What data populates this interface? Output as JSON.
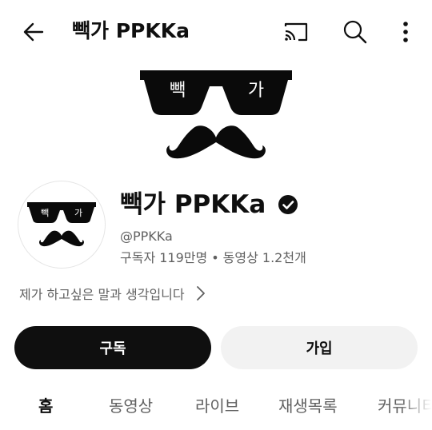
{
  "topbar": {
    "title": "빽가 PPKKa",
    "back_icon": "arrow-left-icon",
    "cast_icon": "cast-icon",
    "search_icon": "search-icon",
    "more_icon": "more-vert-icon"
  },
  "banner": {
    "lens_left_text": "빽",
    "lens_right_text": "가"
  },
  "channel": {
    "name": "빽가 PPKKa",
    "verified_icon": "verified-check-icon",
    "handle": "@PPKKa",
    "subscribers": "구독자 119만명",
    "separator": "•",
    "videos": "동영상 1.2천개",
    "description": "제가 하고싶은 말과 생각입니다",
    "avatar_lens_left": "빽",
    "avatar_lens_right": "가"
  },
  "actions": {
    "subscribe_label": "구독",
    "join_label": "가입"
  },
  "tabs": [
    {
      "label": "홈",
      "active": true
    },
    {
      "label": "동영상",
      "active": false
    },
    {
      "label": "라이브",
      "active": false
    },
    {
      "label": "재생목록",
      "active": false
    },
    {
      "label": "커뮤니티",
      "active": false
    }
  ],
  "colors": {
    "primary_text": "#0f0f0f",
    "secondary_text": "#606060",
    "subscribe_bg": "#0f0f0f",
    "join_bg": "#f2f2f2"
  }
}
